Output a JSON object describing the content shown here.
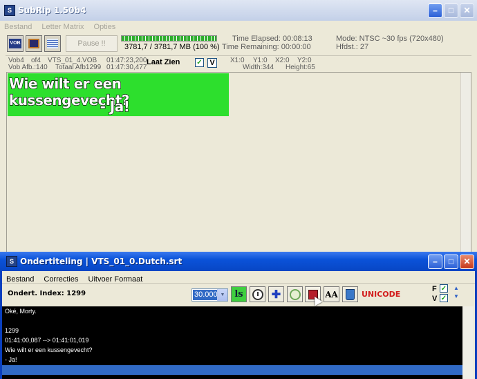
{
  "main": {
    "title": "SubRip 1.50b4",
    "menu": [
      "Bestand",
      "Letter Matrix",
      "Opties"
    ],
    "toolbar": {
      "vob_label": "VOB",
      "pause_label": "Pause !!"
    },
    "progress": {
      "fraction": 1.0,
      "text": "3781,7 / 3781,7 MB (100 %)"
    },
    "time_elapsed": "Time Elapsed: 00:08:13",
    "time_remaining": "Time Remaining: 00:00:00",
    "mode": "Mode: NTSC ~30 fps (720x480)",
    "hfdst": "Hfdst.: 27",
    "info": {
      "vob": "Vob4",
      "of": "of4",
      "vts": "VTS_01_4.VOB",
      "pos": "01:47:23,200",
      "vob_afb": "Vob Afb.:140",
      "totaal": "Totaal Afb1299",
      "pos2": "01:47:30,477",
      "last_zien": "Laat Zien",
      "check_label": "V",
      "x1": "X1:0",
      "y1": "Y1:0",
      "x2": "X2:0",
      "y2": "Y2:0",
      "width": "Width:344",
      "height": "Height:65"
    },
    "preview": {
      "line1": "Wie wilt er een kussengevecht?",
      "line2": "- Ja!",
      "color": "#2ddf2d"
    }
  },
  "subwin": {
    "title": "Ondertiteling | VTS_01_0.Dutch.srt",
    "menu": [
      "Bestand",
      "Correcties",
      "Uitvoer Formaat"
    ],
    "index_label": "Ondert. Index: 1299",
    "fps": "30.000",
    "unicode": "UNICODE",
    "f_label": "F",
    "v_label": "V",
    "lines": [
      "Oké, Morty.",
      "",
      "1299",
      "01:41:00,087 --> 01:41:01,019",
      "Wie wilt er een kussengevecht?",
      "- Ja!"
    ]
  }
}
